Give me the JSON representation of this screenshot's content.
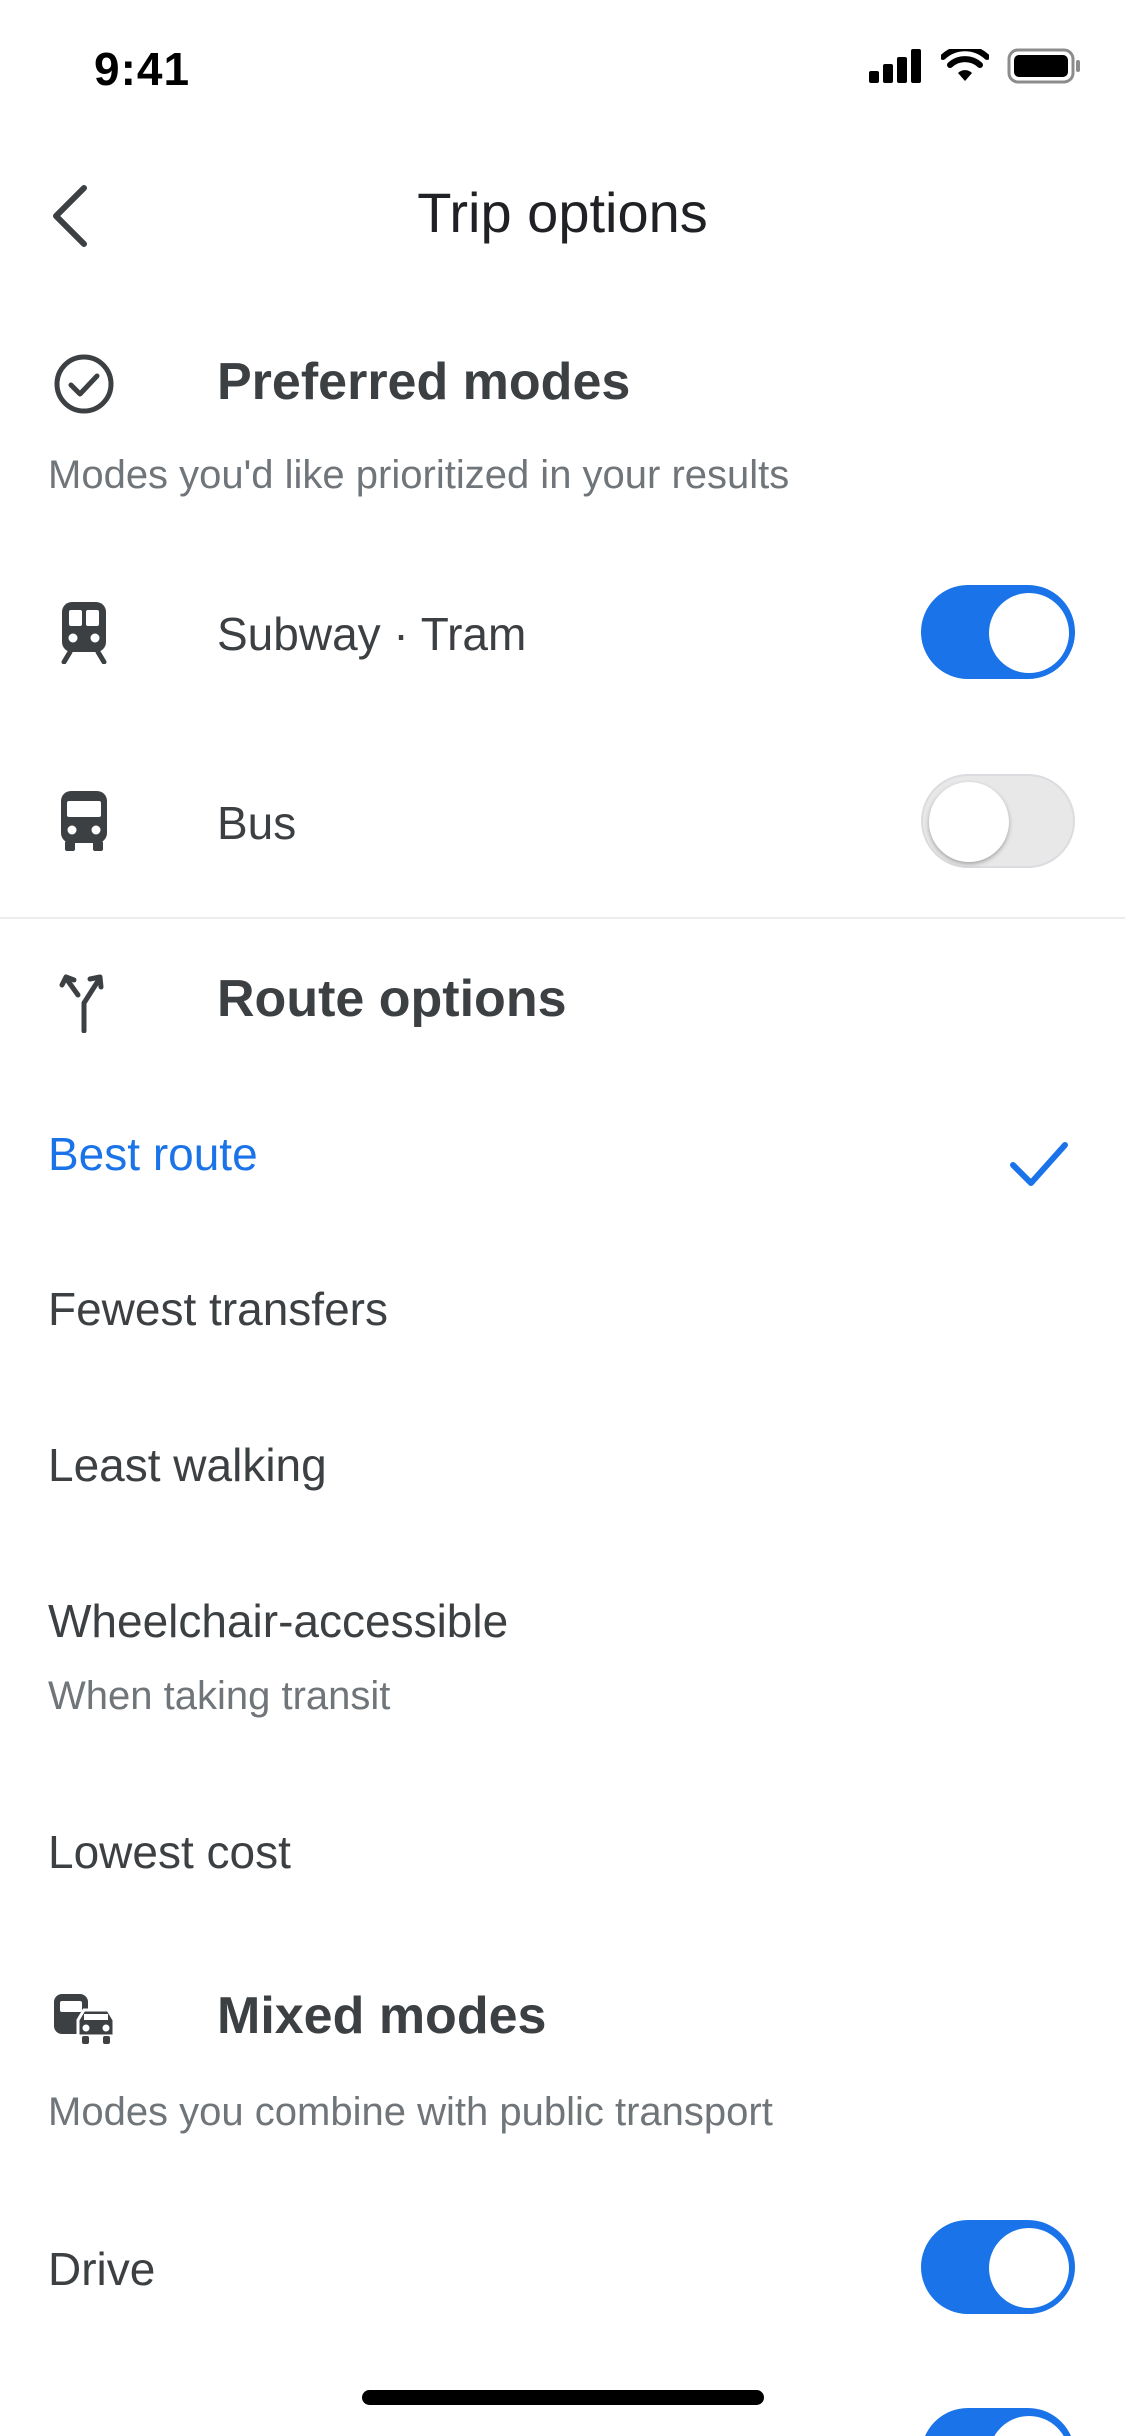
{
  "status_bar": {
    "time": "9:41",
    "icons": [
      "signal-icon",
      "wifi-icon",
      "battery-icon"
    ]
  },
  "header": {
    "title": "Trip options",
    "back_icon": "chevron-left-icon"
  },
  "preferred_modes": {
    "icon": "check-circle-icon",
    "title": "Preferred modes",
    "subtitle": "Modes you'd like prioritized in your results",
    "items": [
      {
        "icon": "subway-icon",
        "label": "Subway · Tram",
        "enabled": true
      },
      {
        "icon": "bus-icon",
        "label": "Bus",
        "enabled": false
      }
    ]
  },
  "route_options": {
    "icon": "fork-arrows-icon",
    "title": "Route options",
    "options": [
      {
        "label": "Best route",
        "selected": true,
        "sub": ""
      },
      {
        "label": "Fewest transfers",
        "selected": false,
        "sub": ""
      },
      {
        "label": "Least walking",
        "selected": false,
        "sub": ""
      },
      {
        "label": "Wheelchair-accessible",
        "selected": false,
        "sub": "When taking transit"
      },
      {
        "label": "Lowest cost",
        "selected": false,
        "sub": ""
      }
    ]
  },
  "mixed_modes": {
    "icon": "bus-car-icon",
    "title": "Mixed modes",
    "subtitle": "Modes you combine with public transport",
    "items": [
      {
        "label": "Drive",
        "enabled": true
      },
      {
        "label": "",
        "enabled": true
      }
    ]
  },
  "colors": {
    "accent": "#1a73e8",
    "text": "#3c4043",
    "secondary_text": "#70757a",
    "divider": "#ececec"
  }
}
